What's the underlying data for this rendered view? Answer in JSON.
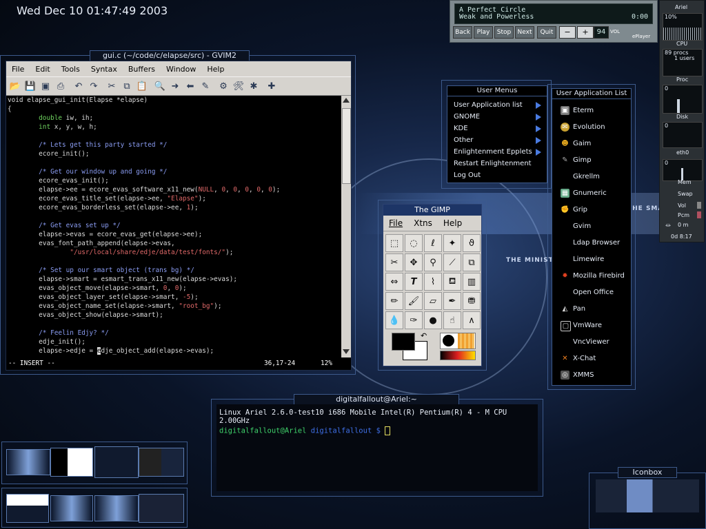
{
  "clock": "Wed Dec 10 01:47:49 2003",
  "wallpaper_text": [
    "THE SMA",
    "THE MINISTR"
  ],
  "gvim": {
    "title": "gui.c (~/code/c/elapse/src) - GVIM2",
    "menus": [
      "File",
      "Edit",
      "Tools",
      "Syntax",
      "Buffers",
      "Window",
      "Help"
    ],
    "status_mode": "-- INSERT --",
    "status_pos": "36,17-24",
    "status_pct": "12%"
  },
  "gimp": {
    "title": "The GIMP",
    "menus": [
      "File",
      "Xtns",
      "Help"
    ]
  },
  "user_menus": {
    "title": "User Menus",
    "items": [
      "User Application list",
      "GNOME",
      "KDE",
      "Other",
      "Enlightenment Epplets",
      "Restart Enlightenment",
      "Log Out"
    ]
  },
  "app_list": {
    "title": "User Application List",
    "items": [
      "Eterm",
      "Evolution",
      "Gaim",
      "Gimp",
      "Gkrellm",
      "Gnumeric",
      "Grip",
      "Gvim",
      "Ldap Browser",
      "Limewire",
      "Mozilla Firebird",
      "Open Office",
      "Pan",
      "VmWare",
      "VncViewer",
      "X-Chat",
      "XMMS"
    ]
  },
  "terminal": {
    "title": "digitalfallout@Ariel:~",
    "line1": "Linux Ariel 2.6.0-test10 i686 Mobile Intel(R) Pentium(R) 4 - M CPU 2.00GHz",
    "user": "digitalfallout@Ariel",
    "path": "digitalfallout",
    "prompt": "$"
  },
  "eplayer": {
    "line1": "A Perfect Circle",
    "line2": "Weak and Powerless",
    "time": "0:00",
    "buttons": [
      "Back",
      "Play",
      "Stop",
      "Next",
      "Quit"
    ],
    "minus": "−",
    "plus": "+",
    "volume": "94",
    "vol_label": "VOL",
    "brand": "ePlayer"
  },
  "gkrellm": {
    "host": "Ariel",
    "cpu_pct": "10%",
    "cpu": "CPU",
    "procs": "89 procs",
    "users": "1 users",
    "proc": "Proc",
    "disk_val": "0",
    "disk": "Disk",
    "net_val": "0",
    "net": "eth0",
    "mem": "Mem",
    "swap": "Swap",
    "vol": "Vol",
    "pcm": "Pcm",
    "battery": "0 m",
    "uptime": "0d 8:17",
    "zero": "0"
  },
  "iconbox": {
    "title": "Iconbox"
  }
}
